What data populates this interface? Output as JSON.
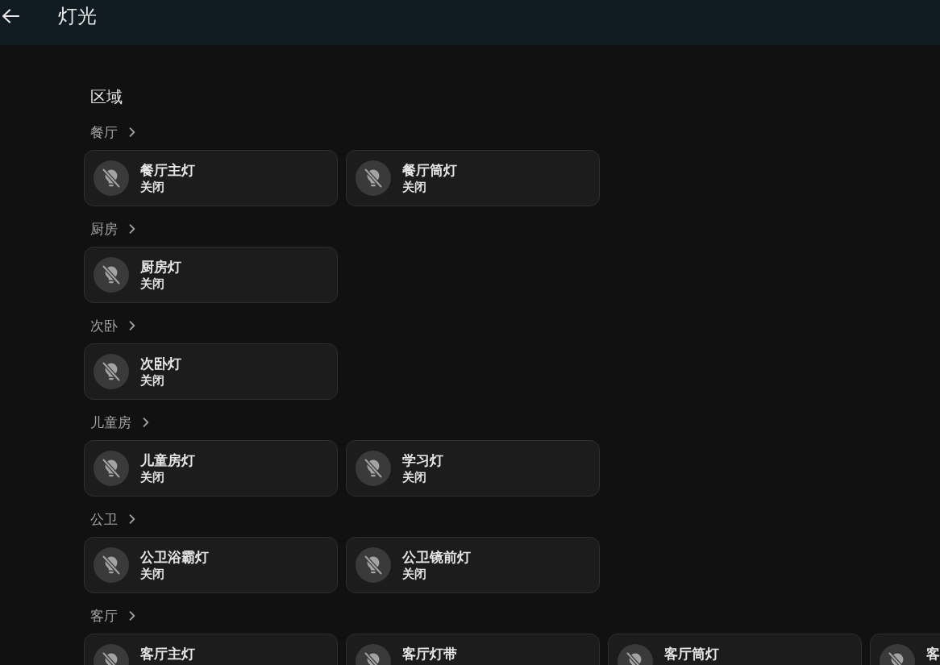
{
  "header": {
    "title": "灯光"
  },
  "section_title": "区域",
  "areas": [
    {
      "name": "餐厅",
      "lights": [
        {
          "name": "餐厅主灯",
          "status": "关闭",
          "on": false
        },
        {
          "name": "餐厅筒灯",
          "status": "关闭",
          "on": false
        }
      ]
    },
    {
      "name": "厨房",
      "lights": [
        {
          "name": "厨房灯",
          "status": "关闭",
          "on": false
        }
      ]
    },
    {
      "name": "次卧",
      "lights": [
        {
          "name": "次卧灯",
          "status": "关闭",
          "on": false
        }
      ]
    },
    {
      "name": "儿童房",
      "lights": [
        {
          "name": "儿童房灯",
          "status": "关闭",
          "on": false
        },
        {
          "name": "学习灯",
          "status": "关闭",
          "on": false
        }
      ]
    },
    {
      "name": "公卫",
      "lights": [
        {
          "name": "公卫浴霸灯",
          "status": "关闭",
          "on": false
        },
        {
          "name": "公卫镜前灯",
          "status": "关闭",
          "on": false
        }
      ]
    },
    {
      "name": "客厅",
      "lights": [
        {
          "name": "客厅主灯",
          "on": false
        },
        {
          "name": "客厅灯带",
          "on": false
        },
        {
          "name": "客厅筒灯",
          "on": false
        },
        {
          "name": "客",
          "on": false
        }
      ]
    }
  ]
}
